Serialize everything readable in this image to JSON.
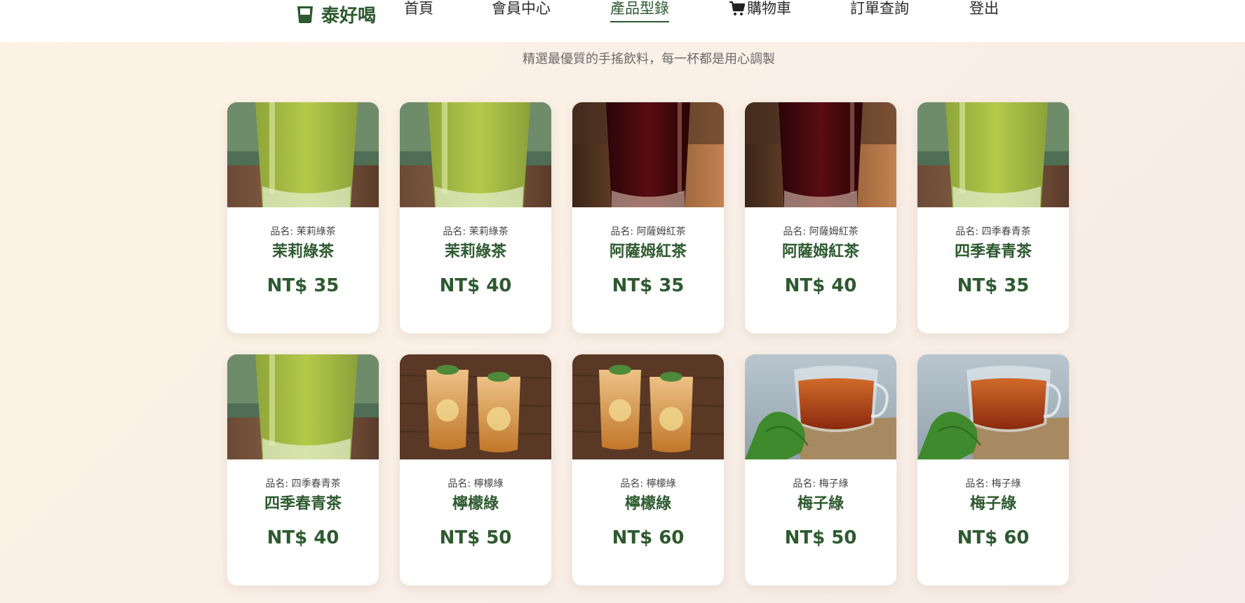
{
  "brand": {
    "name": "泰好喝",
    "icon": "cup-icon",
    "color": "#2d5a2f"
  },
  "nav": {
    "items": [
      {
        "label": "首頁"
      },
      {
        "label": "會員中心"
      },
      {
        "label": "產品型錄",
        "active": true
      },
      {
        "label": "購物車",
        "icon": "cart-icon"
      },
      {
        "label": "訂單查詢"
      },
      {
        "label": "登出"
      }
    ]
  },
  "subtitle": "精選最優質的手搖飲料，每一杯都是用心調製",
  "products": [
    {
      "label": "品名: 茉莉綠茶",
      "name": "茉莉綠茶",
      "price": "NT$ 35",
      "image": "green-tea-glass"
    },
    {
      "label": "品名: 茉莉綠茶",
      "name": "茉莉綠茶",
      "price": "NT$ 40",
      "image": "green-tea-glass"
    },
    {
      "label": "品名: 阿薩姆紅茶",
      "name": "阿薩姆紅茶",
      "price": "NT$ 35",
      "image": "black-tea-glass"
    },
    {
      "label": "品名: 阿薩姆紅茶",
      "name": "阿薩姆紅茶",
      "price": "NT$ 40",
      "image": "black-tea-glass"
    },
    {
      "label": "品名: 四季春青茶",
      "name": "四季春青茶",
      "price": "NT$ 35",
      "image": "green-tea-glass"
    },
    {
      "label": "品名: 四季春青茶",
      "name": "四季春青茶",
      "price": "NT$ 40",
      "image": "green-tea-glass"
    },
    {
      "label": "品名: 檸檬綠",
      "name": "檸檬綠",
      "price": "NT$ 50",
      "image": "lemon-tea-glasses"
    },
    {
      "label": "品名: 檸檬綠",
      "name": "檸檬綠",
      "price": "NT$ 60",
      "image": "lemon-tea-glasses"
    },
    {
      "label": "品名: 梅子綠",
      "name": "梅子綠",
      "price": "NT$ 50",
      "image": "plum-tea-cup"
    },
    {
      "label": "品名: 梅子綠",
      "name": "梅子綠",
      "price": "NT$ 60",
      "image": "plum-tea-cup"
    }
  ]
}
